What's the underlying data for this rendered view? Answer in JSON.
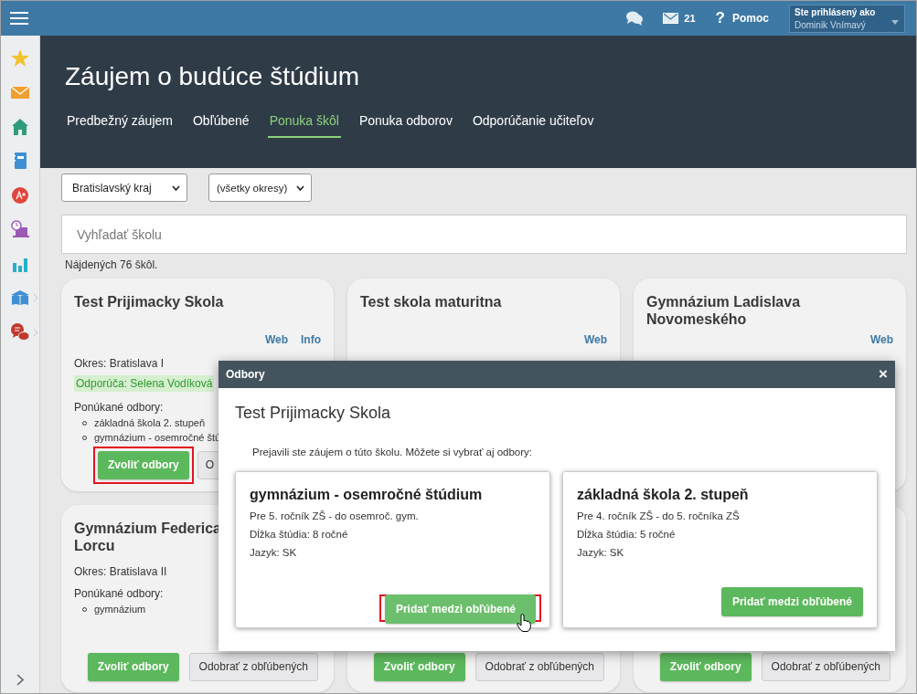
{
  "topbar": {
    "messages_count": "21",
    "help_glyph": "?",
    "help": "Pomoc",
    "user_label": "Ste prihlásený ako",
    "user_name": "Dominik Vnímavý"
  },
  "sidebar": {
    "items": [
      {
        "has_submenu": false
      },
      {
        "has_submenu": false
      },
      {
        "has_submenu": false
      },
      {
        "has_submenu": false
      },
      {
        "has_submenu": false
      },
      {
        "has_submenu": false
      },
      {
        "has_submenu": false
      },
      {
        "has_submenu": true
      },
      {
        "has_submenu": true
      }
    ]
  },
  "header": {
    "title": "Záujem o budúce štúdium",
    "tabs": [
      {
        "label": "Predbežný záujem",
        "selected": false
      },
      {
        "label": "Obľúbené",
        "selected": false
      },
      {
        "label": "Ponuka škôl",
        "selected": true
      },
      {
        "label": "Ponuka odborov",
        "selected": false
      },
      {
        "label": "Odporúčanie učiteľov",
        "selected": false
      }
    ]
  },
  "filters": {
    "region": "Bratislavský kraj",
    "district": "(všetky okresy)",
    "search_placeholder": "Vyhľadať školu",
    "result_count": "Nájdených 76 škôl."
  },
  "cards": [
    {
      "title": "Test Prijimacky Skola",
      "links": [
        "Web",
        "Info"
      ],
      "district": "Okres: Bratislava I",
      "recommended": "Odporúča: Selena Vodíková",
      "offered_label": "Ponúkané odbory:",
      "offered": [
        "základná škola 2. stupeň",
        "gymnázium - osemročné štú"
      ],
      "buttons": [
        {
          "label": "Zvoliť odbory",
          "kind": "primary",
          "highlighted": true
        },
        {
          "label": "O",
          "kind": "secondary",
          "highlighted": false
        }
      ]
    },
    {
      "title": "Test skola maturitna",
      "links": [
        "Web"
      ]
    },
    {
      "title": "Gymnázium Ladislava Novomeského",
      "links": [
        "Web"
      ]
    },
    {
      "title": "Gymnázium Federica Lorcu",
      "district": "Okres: Bratislava II",
      "offered_label": "Ponúkané odbory:",
      "offered": [
        "gymnázium"
      ],
      "buttons": [
        {
          "label": "Zvoliť odbory",
          "kind": "primary",
          "highlighted": false
        },
        {
          "label": "Odobrať z obľúbených",
          "kind": "secondary",
          "highlighted": false
        }
      ]
    },
    {
      "buttons": [
        {
          "label": "Zvoliť odbory",
          "kind": "primary",
          "highlighted": false
        },
        {
          "label": "Odobrať z obľúbených",
          "kind": "secondary",
          "highlighted": false
        }
      ]
    },
    {
      "buttons": [
        {
          "label": "Zvoliť odbory",
          "kind": "primary",
          "highlighted": false
        },
        {
          "label": "Odobrať z obľúbených",
          "kind": "secondary",
          "highlighted": false
        }
      ]
    }
  ],
  "modal": {
    "title": "Odbory",
    "close": "×",
    "school": "Test Prijimacky Skola",
    "intro": "Prejavili ste záujem o túto školu. Môžete si vybrať aj odbory:",
    "programs": [
      {
        "name": "gymnázium - osemročné štúdium",
        "lines": [
          "Pre 5. ročník ZŠ - do osemroč. gym.",
          "Dĺžka štúdia: 8 ročné",
          "Jazyk: SK"
        ],
        "button": "Pridať medzi obľúbené",
        "highlighted": true
      },
      {
        "name": "základná škola 2. stupeň",
        "lines": [
          "Pre 4. ročník ZŠ - do 5. ročníka ZŠ",
          "Dĺžka štúdia: 5 ročné",
          "Jazyk: SK"
        ],
        "button": "Pridať medzi obľúbené",
        "highlighted": false
      }
    ]
  }
}
